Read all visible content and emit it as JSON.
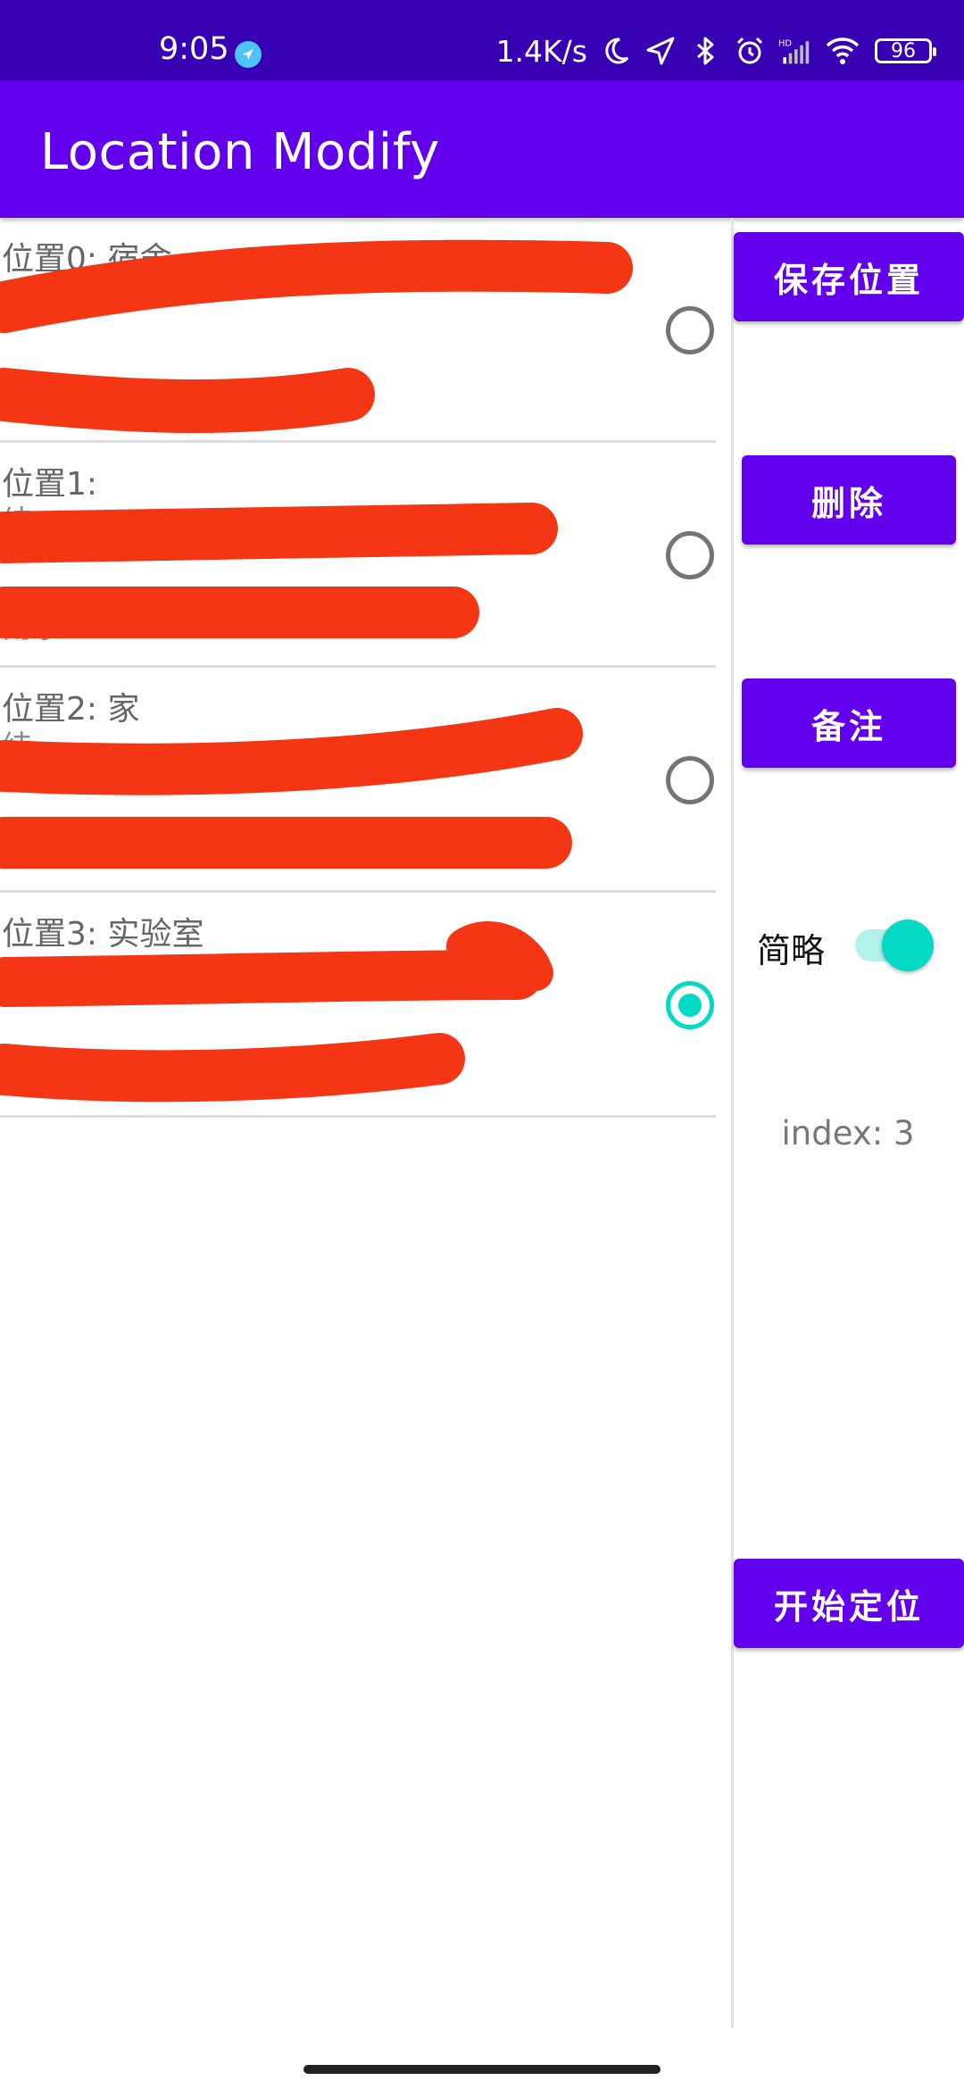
{
  "status_bar": {
    "time": "9:05",
    "net_speed": "1.4K/s",
    "battery": "96",
    "icons": [
      "location-badge-icon",
      "moon-icon",
      "navigation-icon",
      "bluetooth-icon",
      "alarm-icon",
      "hd-signal-icon",
      "wifi-icon",
      "battery-icon"
    ]
  },
  "app_bar": {
    "title": "Location Modify"
  },
  "locations": [
    {
      "title": "位置0: 宿舍",
      "line2": "纬",
      "line3": "",
      "checked": false
    },
    {
      "title": "位置1:",
      "line2": "纬",
      "line3": "南京",
      "checked": false
    },
    {
      "title": "位置2: 家",
      "line2": "纬",
      "line3": "",
      "checked": false
    },
    {
      "title": "位置3: 实验室",
      "line2": "",
      "line3": "",
      "checked": true
    }
  ],
  "actions": {
    "save_label": "保存位置",
    "delete_label": "删除",
    "note_label": "备注",
    "start_label": "开始定位"
  },
  "brief_toggle": {
    "label": "简略",
    "on": true
  },
  "index_text": "index: 3",
  "colors": {
    "status_bar": "#3700b3",
    "primary": "#6200ee",
    "accent": "#03dac5",
    "redaction": "#f53614"
  }
}
